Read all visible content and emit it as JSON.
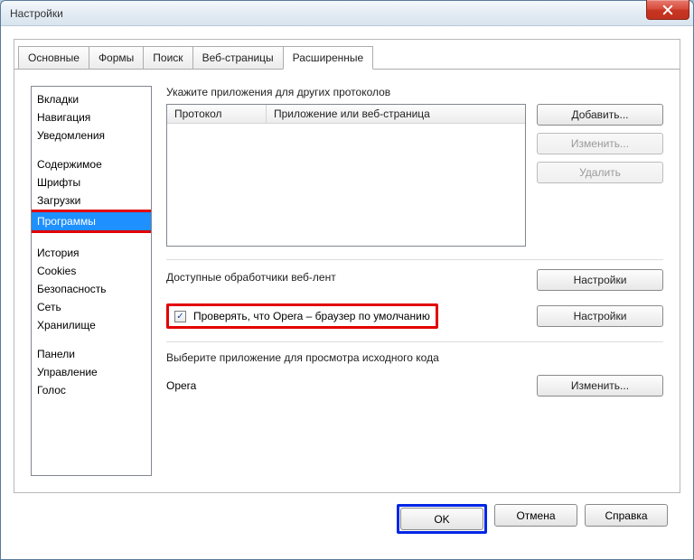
{
  "window": {
    "title": "Настройки"
  },
  "tabs": [
    {
      "label": "Основные"
    },
    {
      "label": "Формы"
    },
    {
      "label": "Поиск"
    },
    {
      "label": "Веб-страницы"
    },
    {
      "label": "Расширенные"
    }
  ],
  "sidebar": {
    "group1": [
      "Вкладки",
      "Навигация",
      "Уведомления"
    ],
    "group2": [
      "Содержимое",
      "Шрифты",
      "Загрузки",
      "Программы"
    ],
    "group3": [
      "История",
      "Cookies",
      "Безопасность",
      "Сеть",
      "Хранилище"
    ],
    "group4": [
      "Панели",
      "Управление",
      "Голос"
    ]
  },
  "main": {
    "protocols_label": "Укажите приложения для других протоколов",
    "table": {
      "col1": "Протокол",
      "col2": "Приложение или веб-страница"
    },
    "buttons": {
      "add": "Добавить...",
      "edit": "Изменить...",
      "delete": "Удалить"
    },
    "feeds_label": "Доступные обработчики веб-лент",
    "settings_btn": "Настройки",
    "default_check": "Проверять, что Opera – браузер по умолчанию",
    "source_label": "Выберите приложение для просмотра исходного кода",
    "source_app": "Opera",
    "change_btn": "Изменить..."
  },
  "footer": {
    "ok": "OK",
    "cancel": "Отмена",
    "help": "Справка"
  }
}
